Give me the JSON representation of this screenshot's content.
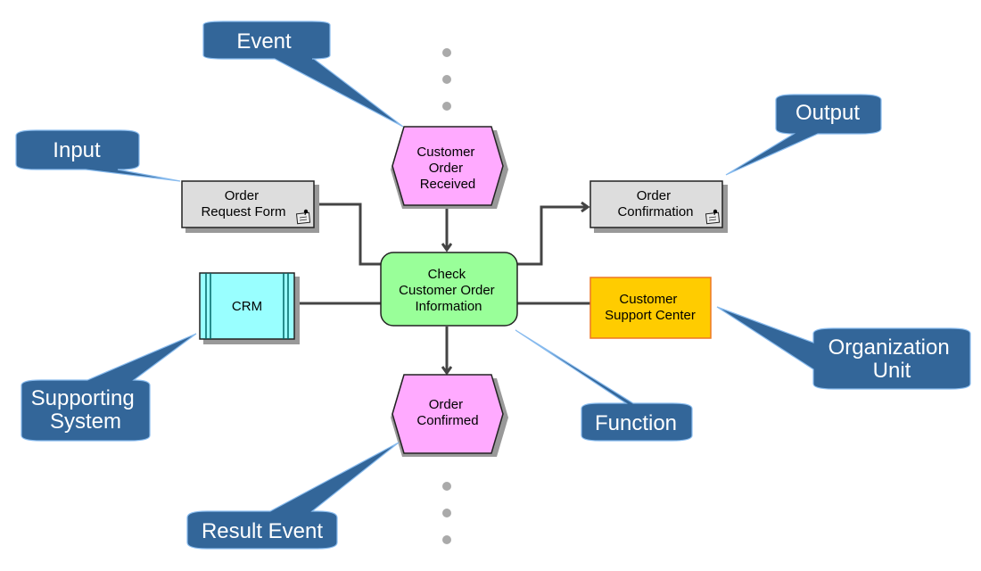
{
  "diagram": {
    "type": "EPC process diagram",
    "colors": {
      "event_fill": "#ffaaff",
      "function_fill": "#99ff99",
      "document_fill": "#dddddd",
      "system_fill": "#99ffff",
      "org_unit_fill": "#ffcc00",
      "org_unit_border": "#ee7722",
      "callout_fill": "#336699",
      "callout_border": "#88bbee",
      "connector": "#444444",
      "shadow": "#999999",
      "ellipsis_dot": "#aaaaaa"
    },
    "nodes": {
      "event_received": {
        "kind": "event",
        "lines": [
          "Customer",
          "Order",
          "Received"
        ]
      },
      "function": {
        "kind": "function",
        "lines": [
          "Check",
          "Customer Order",
          "Information"
        ]
      },
      "event_confirmed": {
        "kind": "event",
        "lines": [
          "Order",
          "Confirmed"
        ]
      },
      "input_doc": {
        "kind": "document",
        "lines": [
          "Order",
          "Request Form"
        ],
        "icon": "document-note-icon"
      },
      "output_doc": {
        "kind": "document",
        "lines": [
          "Order",
          "Confirmation"
        ],
        "icon": "document-note-icon"
      },
      "system": {
        "kind": "application-system",
        "lines": [
          "CRM"
        ]
      },
      "org_unit": {
        "kind": "organization-unit",
        "lines": [
          "Customer",
          "Support Center"
        ]
      }
    },
    "callouts": {
      "event": {
        "lines": [
          "Event"
        ]
      },
      "input": {
        "lines": [
          "Input"
        ]
      },
      "output": {
        "lines": [
          "Output"
        ]
      },
      "supporting_system": {
        "lines": [
          "Supporting",
          "System"
        ]
      },
      "organization_unit": {
        "lines": [
          "Organization",
          "Unit"
        ]
      },
      "function": {
        "lines": [
          "Function"
        ]
      },
      "result_event": {
        "lines": [
          "Result Event"
        ]
      }
    },
    "connections": [
      {
        "from": "event_received",
        "to": "function",
        "arrow": true
      },
      {
        "from": "function",
        "to": "event_confirmed",
        "arrow": true
      },
      {
        "from": "input_doc",
        "to": "function",
        "arrow": false
      },
      {
        "from": "function",
        "to": "output_doc",
        "arrow": true
      },
      {
        "from": "system",
        "to": "function",
        "arrow": false
      },
      {
        "from": "org_unit",
        "to": "function",
        "arrow": false
      }
    ],
    "continuation_markers": [
      "top-ellipsis",
      "bottom-ellipsis"
    ]
  }
}
